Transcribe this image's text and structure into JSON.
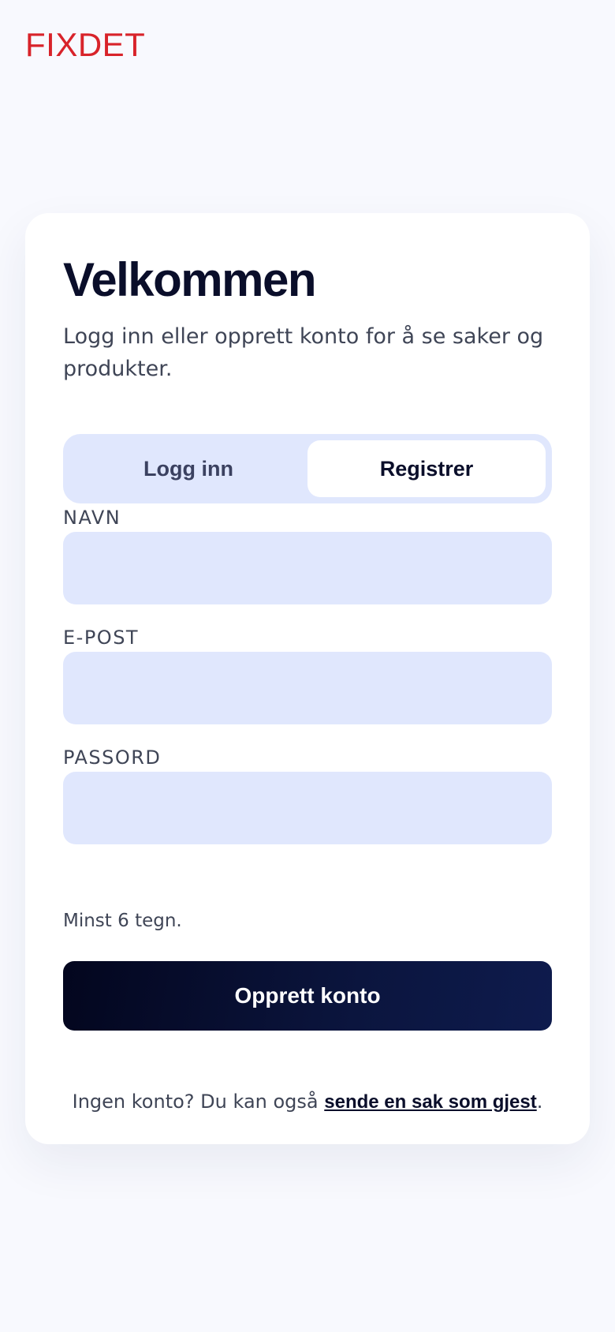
{
  "brand": {
    "logo_text": "FIXDET",
    "color": "#d8232a"
  },
  "card": {
    "title": "Velkommen",
    "subtitle": "Logg inn eller opprett konto for å se saker og produkter."
  },
  "tabs": [
    {
      "label": "Logg inn",
      "active": false
    },
    {
      "label": "Registrer",
      "active": true
    }
  ],
  "form": {
    "name_label": "NAVN",
    "name_value": "",
    "email_label": "E-POST",
    "email_value": "",
    "password_label": "PASSORD",
    "password_value": "",
    "password_hint": "Minst 6 tegn.",
    "submit_label": "Opprett konto"
  },
  "footer": {
    "text": "Ingen konto? Du kan også ",
    "link_text": "sende en sak som gjest",
    "suffix": "."
  },
  "colors": {
    "background": "#f8f9fe",
    "field": "#e0e7fd",
    "primary": "#0a0e2a"
  }
}
